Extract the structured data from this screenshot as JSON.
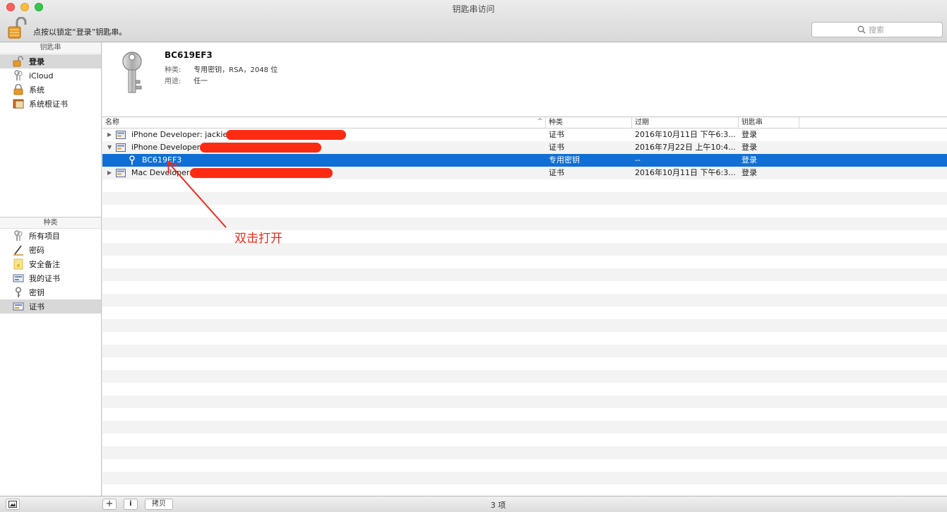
{
  "window": {
    "title": "钥匙串访问",
    "lock_message": "点按以锁定“登录”钥匙串。"
  },
  "search": {
    "placeholder": "搜索"
  },
  "sidebar": {
    "keychains_header": "钥匙串",
    "keychains": [
      {
        "label": "登录",
        "icon": "lock-open-icon"
      },
      {
        "label": "iCloud",
        "icon": "keys-icon"
      },
      {
        "label": "系统",
        "icon": "lock-icon"
      },
      {
        "label": "系统根证书",
        "icon": "cabinet-icon"
      }
    ],
    "categories_header": "种类",
    "categories": [
      {
        "label": "所有项目",
        "icon": "keys-icon"
      },
      {
        "label": "密码",
        "icon": "pen-icon"
      },
      {
        "label": "安全备注",
        "icon": "note-icon"
      },
      {
        "label": "我的证书",
        "icon": "certificate-icon"
      },
      {
        "label": "密钥",
        "icon": "key-icon"
      },
      {
        "label": "证书",
        "icon": "certificate-icon"
      }
    ]
  },
  "detail": {
    "name": "BC619EF3",
    "kind_label": "种类:",
    "kind_value": "专用密钥，RSA，2048 位",
    "usage_label": "用途:",
    "usage_value": "任一"
  },
  "table": {
    "columns": [
      "名称",
      "种类",
      "过期",
      "钥匙串"
    ],
    "rows": [
      {
        "name": "iPhone Developer: jackie",
        "kind": "证书",
        "expires": "2016年10月11日 下午6:3...",
        "keychain": "登录"
      },
      {
        "name": "iPhone Developer:",
        "kind": "证书",
        "expires": "2016年7月22日 上午10:4...",
        "keychain": "登录"
      },
      {
        "name": "BC619EF3",
        "kind": "专用密钥",
        "expires": "--",
        "keychain": "登录"
      },
      {
        "name": "Mac Developer:",
        "kind": "证书",
        "expires": "2016年10月11日 下午6:3...",
        "keychain": "登录"
      }
    ]
  },
  "annotation": {
    "text": "双击打开",
    "color": "#f0291a"
  },
  "bottom": {
    "add_label": "+",
    "info_label": "i",
    "copy_label": "拷贝",
    "status": "3 项"
  },
  "colors": {
    "selection": "#0f6fd4",
    "redaction": "#ff2a12"
  }
}
